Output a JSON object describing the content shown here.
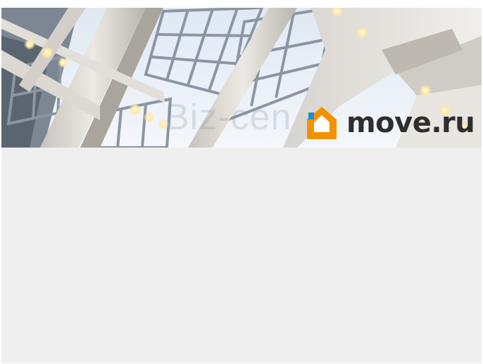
{
  "banner": {
    "watermark_text": "Biz-cen",
    "brand_name": "move.ru",
    "brand_icon": "house-icon",
    "colors": {
      "brand_orange": "#f39200",
      "brand_blue": "#1e8fd5",
      "brand_text": "#2e2e2e",
      "content_background": "#efefef"
    }
  }
}
